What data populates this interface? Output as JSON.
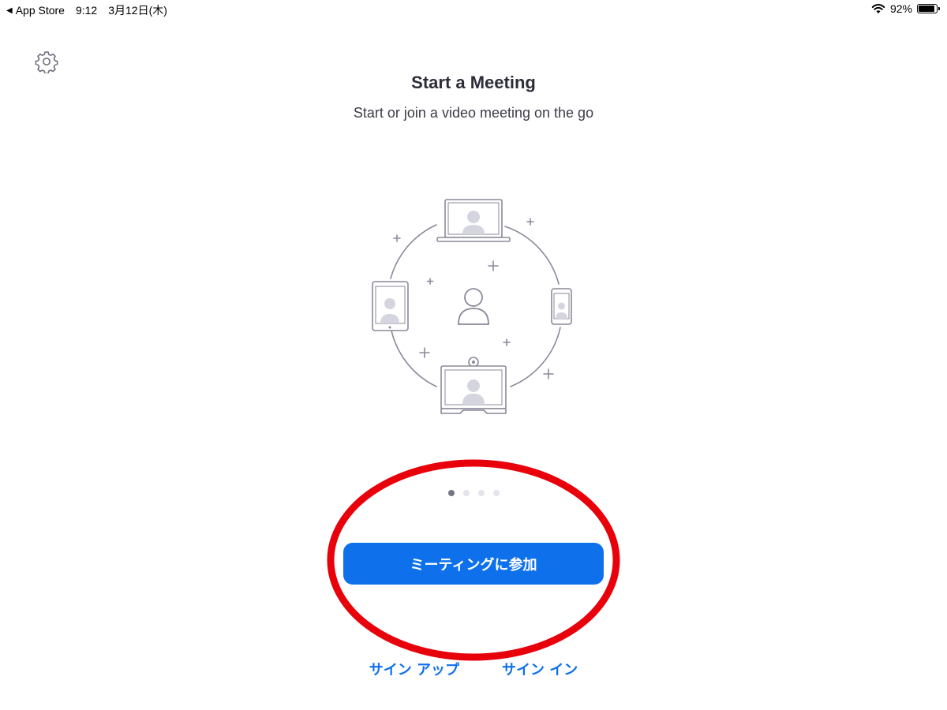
{
  "status_bar": {
    "back_app": "App Store",
    "time": "9:12",
    "date": "3月12日(木)",
    "battery_percent": "92%",
    "battery_level": 0.92
  },
  "header": {
    "settings_icon": "gear-icon"
  },
  "main": {
    "title": "Start a Meeting",
    "subtitle": "Start or join a video meeting on the go",
    "illustration_icon": "video-meeting-devices-illustration",
    "page_indicator": {
      "total": 4,
      "active": 1
    },
    "join_button_label": "ミーティングに参加",
    "sign_up_label": "サイン アップ",
    "sign_in_label": "サイン イン"
  },
  "colors": {
    "accent": "#0e71eb",
    "annotation": "#e8000b",
    "text": "#232333"
  }
}
